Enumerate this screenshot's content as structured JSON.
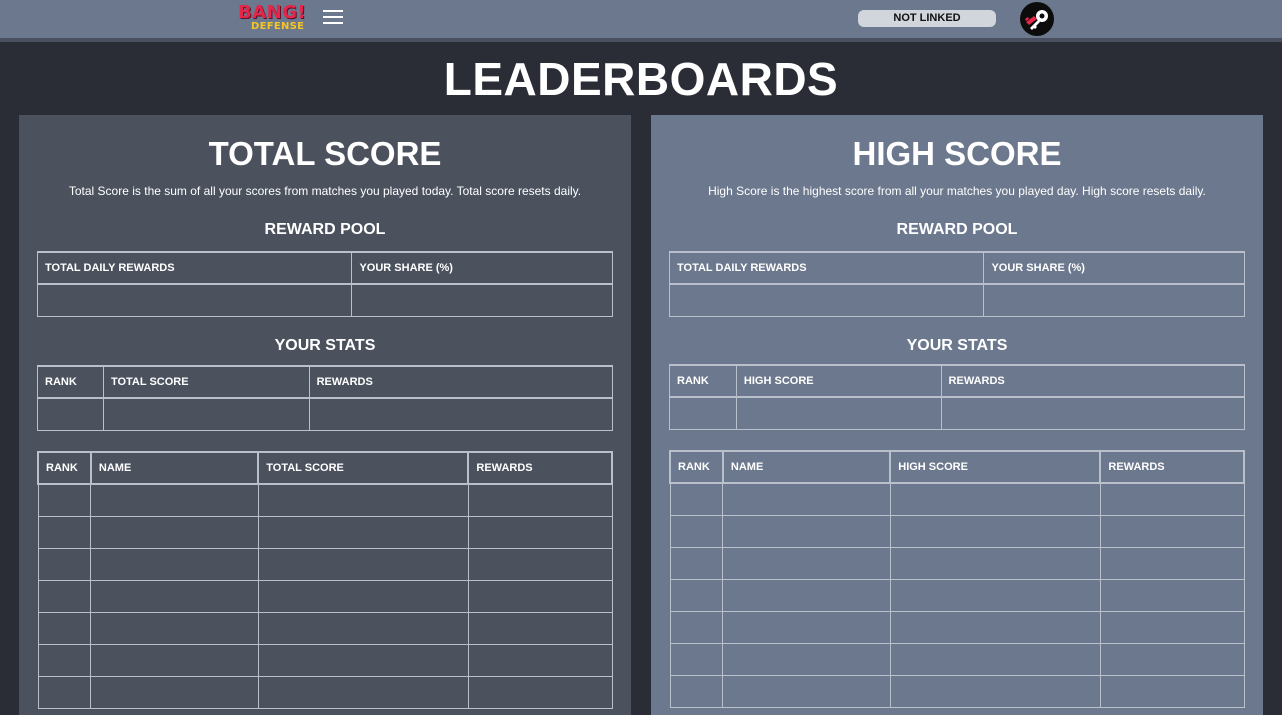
{
  "header": {
    "logo_top": "BANG!",
    "logo_bottom": "DEFENSE",
    "link_status": "NOT LINKED"
  },
  "page_title": "LEADERBOARDS",
  "panels": [
    {
      "title": "TOTAL SCORE",
      "description": "Total Score is the sum of all your scores from matches you played today. Total score resets daily.",
      "reward_pool": {
        "heading": "REWARD POOL",
        "columns": [
          "TOTAL DAILY REWARDS",
          "YOUR SHARE (%)"
        ]
      },
      "your_stats": {
        "heading": "YOUR STATS",
        "columns": [
          "RANK",
          "TOTAL SCORE",
          "REWARDS"
        ]
      },
      "leaderboard": {
        "columns": [
          "RANK",
          "NAME",
          "TOTAL SCORE",
          "REWARDS"
        ]
      }
    },
    {
      "title": "HIGH SCORE",
      "description": "High Score is the highest score from all your matches you played day. High score resets daily.",
      "reward_pool": {
        "heading": "REWARD POOL",
        "columns": [
          "TOTAL DAILY REWARDS",
          "YOUR SHARE (%)"
        ]
      },
      "your_stats": {
        "heading": "YOUR STATS",
        "columns": [
          "RANK",
          "HIGH SCORE",
          "REWARDS"
        ]
      },
      "leaderboard": {
        "columns": [
          "RANK",
          "NAME",
          "HIGH SCORE",
          "REWARDS"
        ]
      }
    }
  ]
}
